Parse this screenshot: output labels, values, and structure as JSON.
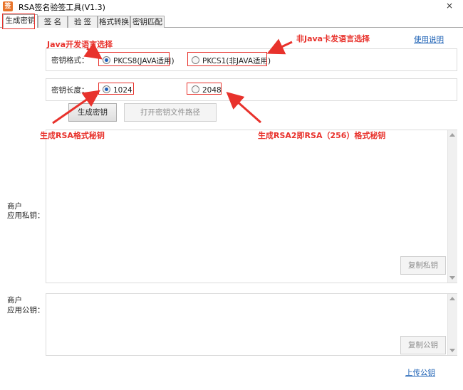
{
  "window": {
    "title": "RSA签名验签工具(V1.3)",
    "close_glyph": "×",
    "icon_glyph": "签"
  },
  "tabs": [
    {
      "label": "生成密钥",
      "active": true
    },
    {
      "label": "签 名",
      "active": false
    },
    {
      "label": "验 签",
      "active": false
    },
    {
      "label": "格式转换",
      "active": false
    },
    {
      "label": "密钥匹配",
      "active": false
    }
  ],
  "help_link": "使用说明",
  "key_format": {
    "label": "密钥格式：",
    "options": [
      {
        "label": "PKCS8(JAVA适用)",
        "selected": true
      },
      {
        "label": "PKCS1(非JAVA适用)",
        "selected": false
      }
    ]
  },
  "key_length": {
    "label": "密钥长度：",
    "options": [
      {
        "label": "1024",
        "selected": true
      },
      {
        "label": "2048",
        "selected": false
      }
    ]
  },
  "buttons": {
    "generate": "生成密钥",
    "open_path": "打开密钥文件路径",
    "copy_private": "复制私钥",
    "copy_public": "复制公钥"
  },
  "private_key": {
    "label_line1": "商户",
    "label_line2": "应用私钥：",
    "value": ""
  },
  "public_key": {
    "label_line1": "商户",
    "label_line2": "应用公钥：",
    "value": ""
  },
  "upload_link": "上传公钥",
  "annotations": {
    "java": "Java开发语言选择",
    "non_java": "非Java卡发语言选择",
    "rsa": "生成RSA格式秘钥",
    "rsa2": "生成RSA2即RSA（256）格式秘钥"
  },
  "colors": {
    "annotation": "#e8322c",
    "link": "#1a5fb4",
    "radio_selected": "#1f5fb8",
    "app_icon": "#e8732a"
  }
}
